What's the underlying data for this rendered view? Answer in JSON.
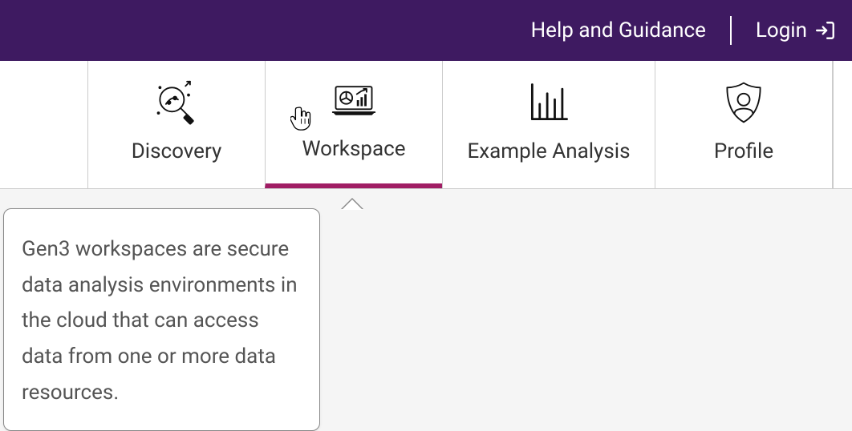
{
  "header": {
    "help_label": "Help and Guidance",
    "login_label": "Login"
  },
  "tabs": {
    "discovery": {
      "label": "Discovery"
    },
    "workspace": {
      "label": "Workspace",
      "active": true
    },
    "example_analysis": {
      "label": "Example Analysis"
    },
    "profile": {
      "label": "Profile"
    }
  },
  "tooltip": {
    "text": "Gen3 workspaces are secure data analysis environments in the cloud that can access data from one or more data resources."
  },
  "colors": {
    "header_bg": "#3e1a61",
    "active_underline": "#a01d64"
  }
}
